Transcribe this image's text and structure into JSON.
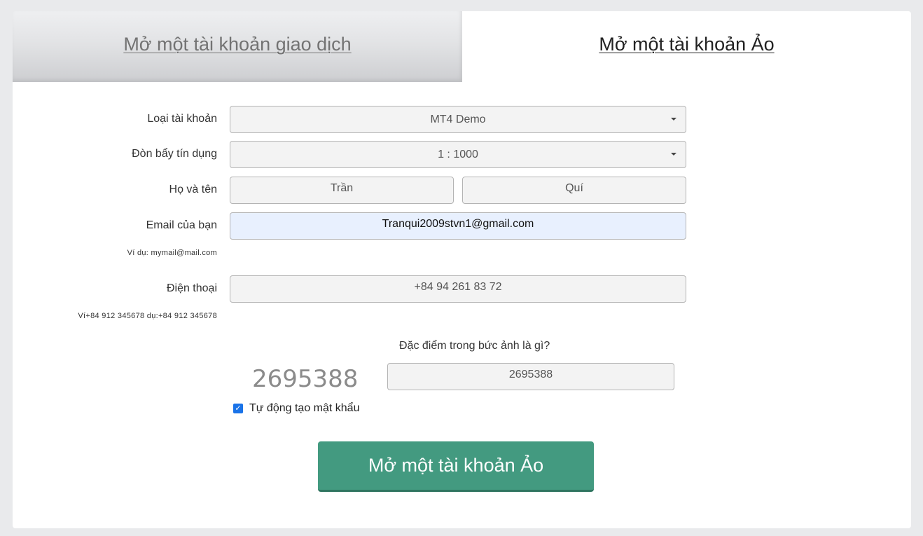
{
  "tabs": {
    "real_account": "Mở một tài khoản giao dịch",
    "demo_account": "Mở một tài khoản Ảo"
  },
  "form": {
    "account_type": {
      "label": "Loại tài khoản",
      "value": "MT4 Demo"
    },
    "leverage": {
      "label": "Đòn bẩy tín dụng",
      "value": "1 : 1000"
    },
    "name": {
      "label": "Họ và tên",
      "first": "Trần",
      "last": "Quí"
    },
    "email": {
      "label": "Email của bạn",
      "value": "Tranqui2009stvn1@gmail.com",
      "hint": "Ví dụ: mymail@mail.com"
    },
    "phone": {
      "label": "Điện thoại",
      "value": "+84 94 261 83 72",
      "hint": "Ví+84 912 345678 dụ:+84 912 345678"
    },
    "captcha": {
      "question": "Đặc điểm trong bức ảnh là gì?",
      "image_text": "2695388",
      "answer": "2695388"
    },
    "auto_password": {
      "label": "Tự động tạo mật khẩu",
      "checked": true
    },
    "submit_label": "Mở một tài khoản Ảo"
  },
  "colors": {
    "submit_bg": "#439a80",
    "checkbox": "#1a73e8",
    "autofill_bg": "#e8f0fe"
  }
}
